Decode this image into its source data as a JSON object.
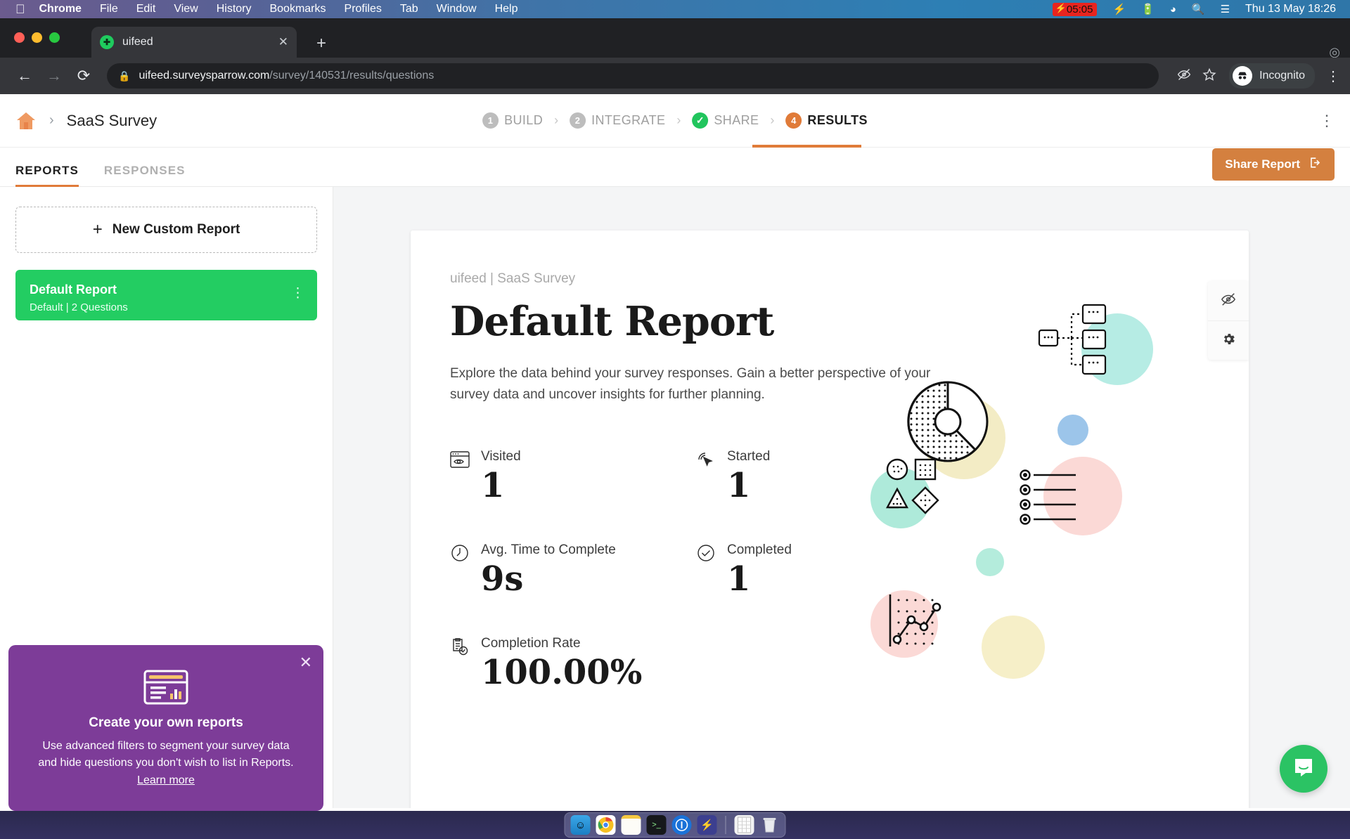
{
  "menubar": {
    "apple_icon": "apple-icon",
    "items": [
      "Chrome",
      "File",
      "Edit",
      "View",
      "History",
      "Bookmarks",
      "Profiles",
      "Tab",
      "Window",
      "Help"
    ],
    "battery_timer": "05:05",
    "status_icons": [
      "bolt-icon",
      "battery-charging-icon",
      "wifi-icon",
      "search-icon",
      "control-center-icon"
    ],
    "datetime": "Thu 13 May  18:26"
  },
  "browser": {
    "tab": {
      "title": "uifeed",
      "favicon": "surveysparrow-icon",
      "close_icon": "close-icon"
    },
    "new_tab_icon": "plus-icon",
    "back_icon": "back-arrow-icon",
    "forward_icon": "forward-arrow-icon",
    "reload_icon": "reload-icon",
    "lock_icon": "lock-icon",
    "url_host": "uifeed.surveysparrow.com",
    "url_path": "/survey/140531/results/questions",
    "toolbar_icons": [
      "eye-slash-icon",
      "star-icon"
    ],
    "profile_label": "Incognito",
    "menu_icon": "three-dot-menu-icon"
  },
  "header": {
    "home_icon": "home-icon",
    "breadcrumb_separator": "›",
    "survey_name": "SaaS Survey",
    "steps": [
      {
        "num": "1",
        "label": "BUILD",
        "state": "inactive"
      },
      {
        "num": "2",
        "label": "INTEGRATE",
        "state": "inactive"
      },
      {
        "num": "✓",
        "label": "SHARE",
        "state": "done"
      },
      {
        "num": "4",
        "label": "RESULTS",
        "state": "active"
      }
    ],
    "overflow_icon": "three-dot-menu-icon"
  },
  "subbar": {
    "tabs": [
      {
        "label": "REPORTS",
        "active": true
      },
      {
        "label": "RESPONSES",
        "active": false
      }
    ],
    "share_button": {
      "label": "Share Report",
      "icon": "share-export-icon"
    }
  },
  "sidebar": {
    "new_report": {
      "label": "New Custom Report",
      "icon": "plus-icon"
    },
    "report_card": {
      "title": "Default Report",
      "subtitle": "Default  |  2 Questions",
      "menu_icon": "three-dot-menu-icon"
    },
    "promo": {
      "close_icon": "close-icon",
      "icon": "report-chart-icon",
      "heading": "Create your own reports",
      "body": "Use advanced filters to segment your survey data and hide questions you don't wish to list in Reports. ",
      "link": "Learn more"
    }
  },
  "report": {
    "eyebrow": "uifeed  |  SaaS Survey",
    "title": "Default Report",
    "description": "Explore the data behind your survey responses. Gain a better perspective of your survey data and uncover insights for further planning.",
    "stats": [
      {
        "label": "Visited",
        "value": "1",
        "icon": "browser-eye-icon"
      },
      {
        "label": "Started",
        "value": "1",
        "icon": "cursor-click-icon"
      },
      {
        "label": "Avg. Time to Complete",
        "value": "9s",
        "icon": "clock-icon"
      },
      {
        "label": "Completed",
        "value": "1",
        "icon": "check-circle-icon"
      },
      {
        "label": "Completion Rate",
        "value": "100.00%",
        "icon": "clipboard-check-icon"
      }
    ],
    "side_tools": [
      {
        "icon": "eye-slash-icon",
        "name": "hide-questions"
      },
      {
        "icon": "gear-icon",
        "name": "report-settings"
      }
    ],
    "chat_icon": "intercom-chat-icon"
  },
  "colors": {
    "accent_orange": "#d4803f",
    "green_card": "#23cd62",
    "promo_purple": "#7d3c98",
    "intercom_green": "#2bc364"
  },
  "dock": {
    "apps": [
      "finder-icon",
      "chrome-icon",
      "notes-icon",
      "terminal-icon",
      "1password-icon",
      "lightning-icon"
    ],
    "others": [
      "document-icon",
      "trash-icon"
    ]
  }
}
